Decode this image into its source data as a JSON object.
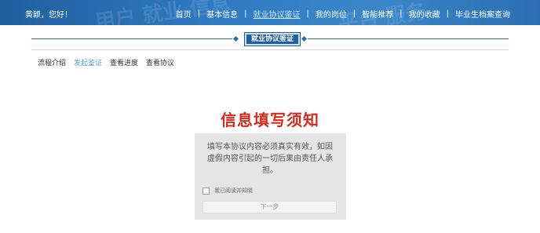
{
  "header": {
    "greeting": "黄颖，您好！",
    "nav": [
      {
        "label": "首页",
        "active": false
      },
      {
        "label": "基本信息",
        "active": false
      },
      {
        "label": "就业协议鉴证",
        "active": true
      },
      {
        "label": "我的岗位",
        "active": false
      },
      {
        "label": "智能推荐",
        "active": false
      },
      {
        "label": "我的收藏",
        "active": false
      },
      {
        "label": "毕业生档案查询",
        "active": false
      }
    ],
    "separator": "|"
  },
  "section": {
    "title": "就业协议鉴证"
  },
  "subnav": {
    "tabs": [
      {
        "label": "流程介绍",
        "active": false
      },
      {
        "label": "发起鉴证",
        "active": true
      },
      {
        "label": "查看进度",
        "active": false
      },
      {
        "label": "查看协议",
        "active": false
      }
    ]
  },
  "main": {
    "heading": "信息填写须知",
    "notice": "填写本协议内容必须真实有效，如因虚假内容引起的一切后果由责任人承担。",
    "agree_label": "我已阅读并知晓",
    "next_label": "下一步"
  },
  "colors": {
    "header_blue": "#2b6fb2",
    "heading_red": "#d52b1e",
    "active_tab": "#5a9bd6"
  }
}
